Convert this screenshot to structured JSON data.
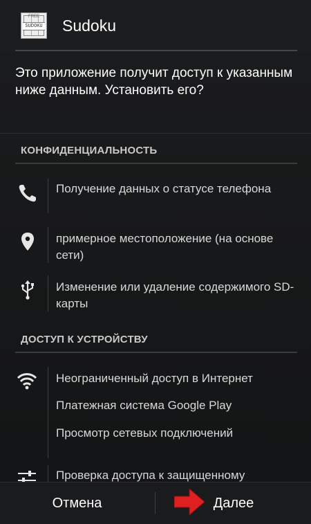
{
  "header": {
    "app_name": "Sudoku",
    "icon_label": "SUDOKU",
    "icon_badge": "FREE"
  },
  "intro": "Это приложение получит доступ к указанным ниже данным. Установить его?",
  "sections": [
    {
      "title": "КОНФИДЕНЦИАЛЬНОСТЬ",
      "items": [
        {
          "icon": "phone-icon",
          "text": "Получение данных о статусе телефона"
        },
        {
          "icon": "location-pin-icon",
          "text": "примерное местоположение (на основе сети)"
        },
        {
          "icon": "usb-icon",
          "text": "Изменение или удаление содержимого SD-карты"
        }
      ]
    },
    {
      "title": "ДОСТУП К УСТРОЙСТВУ",
      "items": [
        {
          "icon": "wifi-icon",
          "texts": [
            "Неограниченный доступ в Интернет",
            "Платежная система Google Play",
            "Просмотр сетевых подключений"
          ]
        },
        {
          "icon": "settings-sliders-icon",
          "text": "Проверка доступа к защищенному"
        }
      ]
    }
  ],
  "buttons": {
    "cancel": "Отмена",
    "next": "Далее"
  },
  "colors": {
    "background": "#161718",
    "text": "#ffffff",
    "divider": "#3a3b3d",
    "arrow": "#e02020"
  }
}
